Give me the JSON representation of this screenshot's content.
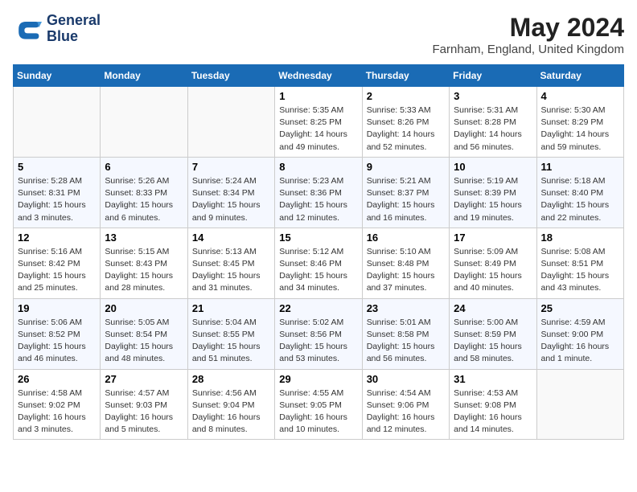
{
  "logo": {
    "name_line1": "General",
    "name_line2": "Blue"
  },
  "title": "May 2024",
  "subtitle": "Farnham, England, United Kingdom",
  "days_of_week": [
    "Sunday",
    "Monday",
    "Tuesday",
    "Wednesday",
    "Thursday",
    "Friday",
    "Saturday"
  ],
  "weeks": [
    [
      {
        "num": "",
        "info": ""
      },
      {
        "num": "",
        "info": ""
      },
      {
        "num": "",
        "info": ""
      },
      {
        "num": "1",
        "info": "Sunrise: 5:35 AM\nSunset: 8:25 PM\nDaylight: 14 hours\nand 49 minutes."
      },
      {
        "num": "2",
        "info": "Sunrise: 5:33 AM\nSunset: 8:26 PM\nDaylight: 14 hours\nand 52 minutes."
      },
      {
        "num": "3",
        "info": "Sunrise: 5:31 AM\nSunset: 8:28 PM\nDaylight: 14 hours\nand 56 minutes."
      },
      {
        "num": "4",
        "info": "Sunrise: 5:30 AM\nSunset: 8:29 PM\nDaylight: 14 hours\nand 59 minutes."
      }
    ],
    [
      {
        "num": "5",
        "info": "Sunrise: 5:28 AM\nSunset: 8:31 PM\nDaylight: 15 hours\nand 3 minutes."
      },
      {
        "num": "6",
        "info": "Sunrise: 5:26 AM\nSunset: 8:33 PM\nDaylight: 15 hours\nand 6 minutes."
      },
      {
        "num": "7",
        "info": "Sunrise: 5:24 AM\nSunset: 8:34 PM\nDaylight: 15 hours\nand 9 minutes."
      },
      {
        "num": "8",
        "info": "Sunrise: 5:23 AM\nSunset: 8:36 PM\nDaylight: 15 hours\nand 12 minutes."
      },
      {
        "num": "9",
        "info": "Sunrise: 5:21 AM\nSunset: 8:37 PM\nDaylight: 15 hours\nand 16 minutes."
      },
      {
        "num": "10",
        "info": "Sunrise: 5:19 AM\nSunset: 8:39 PM\nDaylight: 15 hours\nand 19 minutes."
      },
      {
        "num": "11",
        "info": "Sunrise: 5:18 AM\nSunset: 8:40 PM\nDaylight: 15 hours\nand 22 minutes."
      }
    ],
    [
      {
        "num": "12",
        "info": "Sunrise: 5:16 AM\nSunset: 8:42 PM\nDaylight: 15 hours\nand 25 minutes."
      },
      {
        "num": "13",
        "info": "Sunrise: 5:15 AM\nSunset: 8:43 PM\nDaylight: 15 hours\nand 28 minutes."
      },
      {
        "num": "14",
        "info": "Sunrise: 5:13 AM\nSunset: 8:45 PM\nDaylight: 15 hours\nand 31 minutes."
      },
      {
        "num": "15",
        "info": "Sunrise: 5:12 AM\nSunset: 8:46 PM\nDaylight: 15 hours\nand 34 minutes."
      },
      {
        "num": "16",
        "info": "Sunrise: 5:10 AM\nSunset: 8:48 PM\nDaylight: 15 hours\nand 37 minutes."
      },
      {
        "num": "17",
        "info": "Sunrise: 5:09 AM\nSunset: 8:49 PM\nDaylight: 15 hours\nand 40 minutes."
      },
      {
        "num": "18",
        "info": "Sunrise: 5:08 AM\nSunset: 8:51 PM\nDaylight: 15 hours\nand 43 minutes."
      }
    ],
    [
      {
        "num": "19",
        "info": "Sunrise: 5:06 AM\nSunset: 8:52 PM\nDaylight: 15 hours\nand 46 minutes."
      },
      {
        "num": "20",
        "info": "Sunrise: 5:05 AM\nSunset: 8:54 PM\nDaylight: 15 hours\nand 48 minutes."
      },
      {
        "num": "21",
        "info": "Sunrise: 5:04 AM\nSunset: 8:55 PM\nDaylight: 15 hours\nand 51 minutes."
      },
      {
        "num": "22",
        "info": "Sunrise: 5:02 AM\nSunset: 8:56 PM\nDaylight: 15 hours\nand 53 minutes."
      },
      {
        "num": "23",
        "info": "Sunrise: 5:01 AM\nSunset: 8:58 PM\nDaylight: 15 hours\nand 56 minutes."
      },
      {
        "num": "24",
        "info": "Sunrise: 5:00 AM\nSunset: 8:59 PM\nDaylight: 15 hours\nand 58 minutes."
      },
      {
        "num": "25",
        "info": "Sunrise: 4:59 AM\nSunset: 9:00 PM\nDaylight: 16 hours\nand 1 minute."
      }
    ],
    [
      {
        "num": "26",
        "info": "Sunrise: 4:58 AM\nSunset: 9:02 PM\nDaylight: 16 hours\nand 3 minutes."
      },
      {
        "num": "27",
        "info": "Sunrise: 4:57 AM\nSunset: 9:03 PM\nDaylight: 16 hours\nand 5 minutes."
      },
      {
        "num": "28",
        "info": "Sunrise: 4:56 AM\nSunset: 9:04 PM\nDaylight: 16 hours\nand 8 minutes."
      },
      {
        "num": "29",
        "info": "Sunrise: 4:55 AM\nSunset: 9:05 PM\nDaylight: 16 hours\nand 10 minutes."
      },
      {
        "num": "30",
        "info": "Sunrise: 4:54 AM\nSunset: 9:06 PM\nDaylight: 16 hours\nand 12 minutes."
      },
      {
        "num": "31",
        "info": "Sunrise: 4:53 AM\nSunset: 9:08 PM\nDaylight: 16 hours\nand 14 minutes."
      },
      {
        "num": "",
        "info": ""
      }
    ]
  ]
}
